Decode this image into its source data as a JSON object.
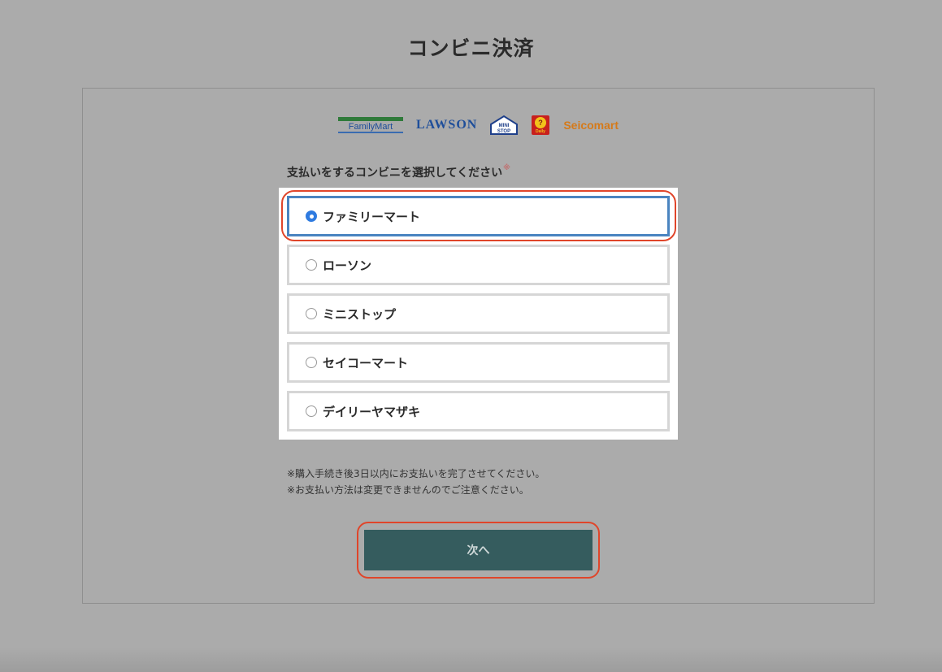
{
  "page": {
    "title": "コンビニ決済"
  },
  "logos": {
    "familymart": "FamilyMart",
    "lawson": "LAWSON",
    "ministop": "MINI STOP",
    "daily": "Daily",
    "seicomart": "Seicomart"
  },
  "form": {
    "question": "支払いをするコンビニを選択してください",
    "required_mark": "※",
    "options": [
      {
        "label": "ファミリーマート",
        "selected": true
      },
      {
        "label": "ローソン",
        "selected": false
      },
      {
        "label": "ミニストップ",
        "selected": false
      },
      {
        "label": "セイコーマート",
        "selected": false
      },
      {
        "label": "デイリーヤマザキ",
        "selected": false
      }
    ],
    "notes": [
      "※購入手続き後3日以内にお支払いを完了させてください。",
      "※お支払い方法は変更できませんのでご注意ください。"
    ],
    "next_label": "次へ"
  },
  "colors": {
    "background": "#ababab",
    "accent_selected": "#4a84c0",
    "radio_checked": "#2f7be0",
    "button": "#355c5e",
    "highlight": "#e0452a"
  }
}
